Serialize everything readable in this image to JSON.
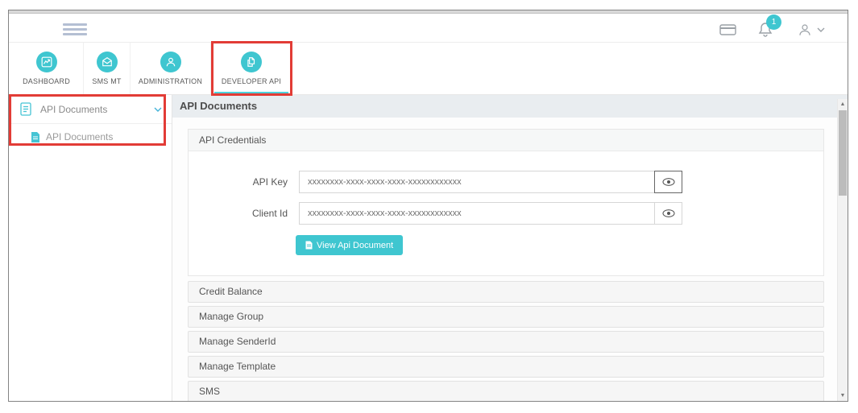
{
  "colors": {
    "teal": "#3fc6d0",
    "annotation_red": "#e23c36",
    "active_underline": "#4fd2dc"
  },
  "topbar": {
    "hamburger_icon": "hamburger-icon",
    "card_icon": "card-icon",
    "bell_icon": "bell-icon",
    "notification_badge": "1",
    "user_icon": "user-icon",
    "user_chevron": "chevron-down-icon"
  },
  "nav": {
    "items": [
      {
        "label": "DASHBOARD",
        "icon": "line-chart-icon",
        "active": false
      },
      {
        "label": "SMS MT",
        "icon": "envelope-icon",
        "active": false
      },
      {
        "label": "ADMINISTRATION",
        "icon": "user-icon",
        "active": false
      },
      {
        "label": "DEVELOPER API",
        "icon": "documents-icon",
        "active": true
      }
    ]
  },
  "sidebar": {
    "items": [
      {
        "label": "API Documents",
        "icon": "document-outline-icon",
        "expanded": true,
        "chevron": "chevron-down-icon",
        "children": [
          {
            "label": "API Documents",
            "icon": "document-filled-icon"
          }
        ]
      }
    ]
  },
  "main": {
    "page_title": "API Documents",
    "credentials_panel": {
      "title": "API Credentials",
      "fields": [
        {
          "label": "API Key",
          "value": "xxxxxxxx-xxxx-xxxx-xxxx-xxxxxxxxxxxx",
          "toggle_icon": "eye-icon"
        },
        {
          "label": "Client Id",
          "value": "xxxxxxxx-xxxx-xxxx-xxxx-xxxxxxxxxxxx",
          "toggle_icon": "eye-icon"
        }
      ],
      "view_button": "View Api Document",
      "view_button_icon": "document-icon"
    },
    "collapsed_panels": [
      "Credit Balance",
      "Manage Group",
      "Manage SenderId",
      "Manage Template",
      "SMS"
    ]
  },
  "annotations": [
    "developer-api-highlight",
    "sidebar-api-documents-highlight"
  ]
}
